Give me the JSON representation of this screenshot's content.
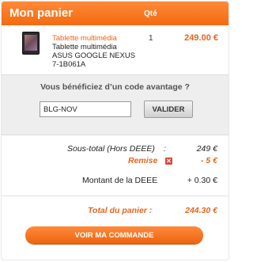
{
  "header": {
    "title": "Mon panier",
    "qty_label": "Qté"
  },
  "item": {
    "category": "Tablette multimédia",
    "name": "Tablette multimédia ASUS GOOGLE NEXUS 7-1B061A",
    "quantity": "1",
    "price": "249.00 €"
  },
  "promo": {
    "question": "Vous bénéficiez d’un code avantage ?",
    "code_value": "BLG-NOV",
    "validate_label": "VALIDER"
  },
  "totals": {
    "subtotal_label": "Sous-total (Hors DEEE)",
    "subtotal_colon": ":",
    "subtotal_value": "249 €",
    "discount_label": "Remise",
    "discount_value": "- 5 €",
    "deee_label": "Montant de la DEEE",
    "deee_value": "+ 0.30 €",
    "total_label": "Total du panier :",
    "total_value": "244.30 €"
  },
  "checkout": {
    "label": "VOIR MA COMMANDE"
  },
  "icons": {
    "remove_discount": "close-icon"
  },
  "colors": {
    "accent": "#f26a10",
    "discount": "#e8641b"
  }
}
